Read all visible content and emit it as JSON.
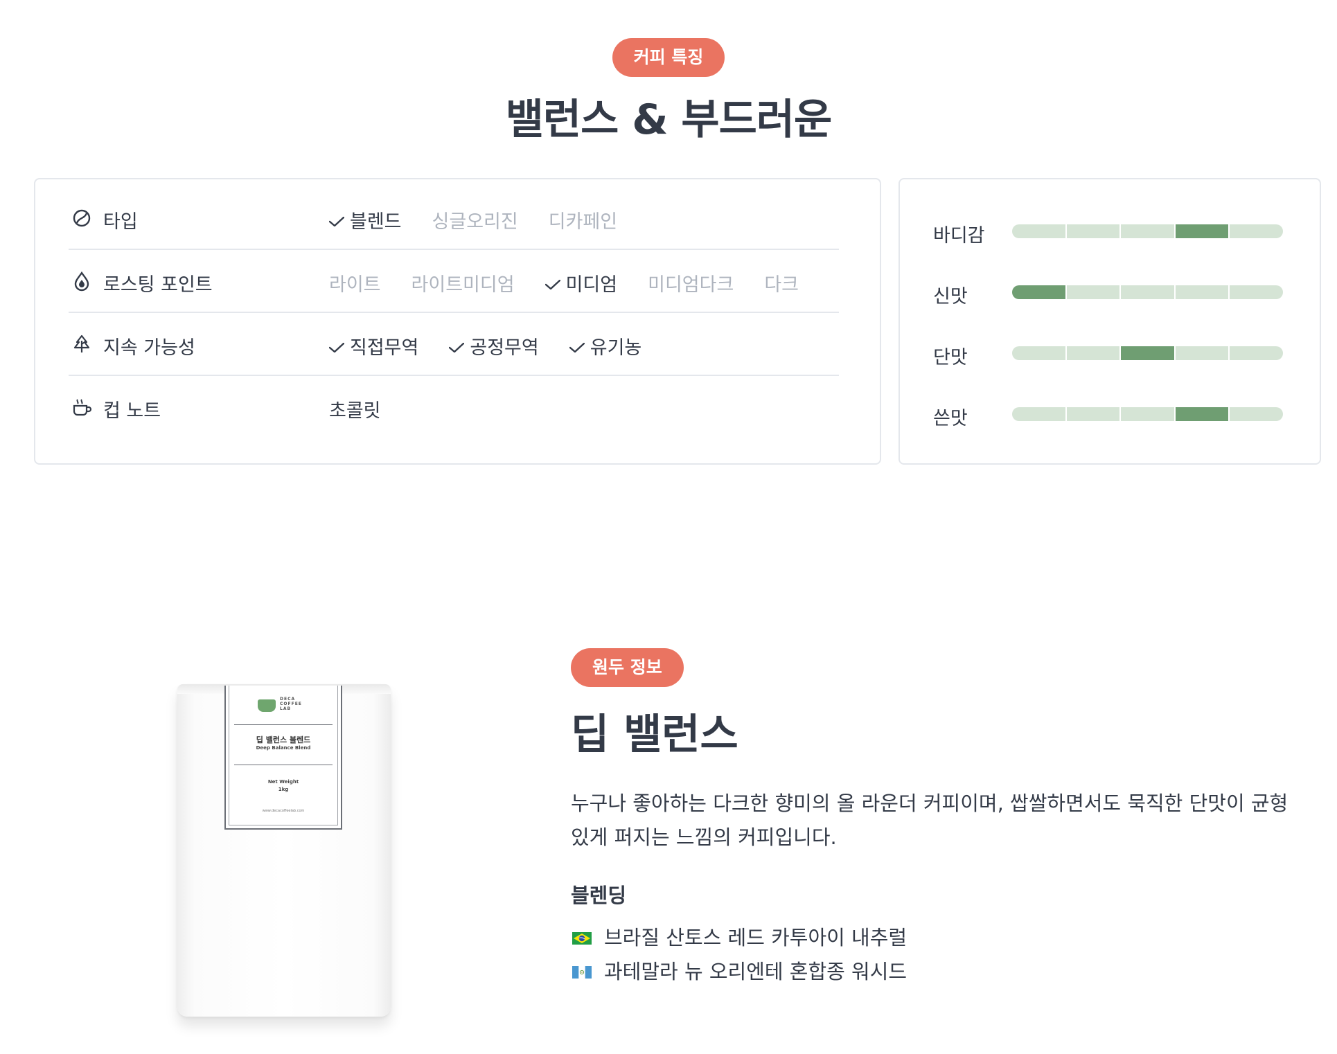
{
  "feature": {
    "badge": "커피 특징",
    "title": "밸런스 & 부드러운"
  },
  "attributes": [
    {
      "icon": "coffee-bean-icon",
      "label": "타입",
      "options": [
        {
          "text": "블렌드",
          "selected": true
        },
        {
          "text": "싱글오리진",
          "selected": false
        },
        {
          "text": "디카페인",
          "selected": false
        }
      ]
    },
    {
      "icon": "droplet-icon",
      "label": "로스팅 포인트",
      "options": [
        {
          "text": "라이트",
          "selected": false
        },
        {
          "text": "라이트미디엄",
          "selected": false
        },
        {
          "text": "미디엄",
          "selected": true
        },
        {
          "text": "미디엄다크",
          "selected": false
        },
        {
          "text": "다크",
          "selected": false
        }
      ]
    },
    {
      "icon": "tree-icon",
      "label": "지속 가능성",
      "options": [
        {
          "text": "직접무역",
          "selected": true
        },
        {
          "text": "공정무역",
          "selected": true
        },
        {
          "text": "유기농",
          "selected": true
        }
      ]
    },
    {
      "icon": "cup-icon",
      "label": "컵 노트",
      "value": "초콜릿"
    }
  ],
  "taste": {
    "max": 5,
    "rows": [
      {
        "label": "바디감",
        "level": 4
      },
      {
        "label": "신맛",
        "level": 1
      },
      {
        "label": "단맛",
        "level": 3
      },
      {
        "label": "쓴맛",
        "level": 4
      }
    ]
  },
  "product": {
    "badge": "원두 정보",
    "name": "딥 밸런스",
    "description": "누구나 좋아하는 다크한 향미의 올 라운더 커피이며, 쌉쌀하면서도 묵직한 단맛이 균형있게 퍼지는 느낌의 커피입니다.",
    "blend_heading": "블렌딩",
    "blend": [
      {
        "flag": "brazil-flag-icon",
        "text": "브라질 산토스 레드 카투아이 내추럴"
      },
      {
        "flag": "guatemala-flag-icon",
        "text": "과테말라 뉴 오리엔테 혼합종 워시드"
      }
    ],
    "package": {
      "brand": "DECA COFFEE LAB",
      "name_ko": "딥 밸런스 블렌드",
      "name_en": "Deep Balance Blend",
      "weight_label": "Net Weight",
      "weight": "1kg",
      "url": "www.decacoffeelab.com"
    }
  },
  "colors": {
    "accent": "#ea7461",
    "text": "#333a47",
    "muted": "#aeb4be",
    "bar_active": "#6f9e72",
    "bar_inactive": "#d5e4d5",
    "border": "#e4e7ec"
  }
}
